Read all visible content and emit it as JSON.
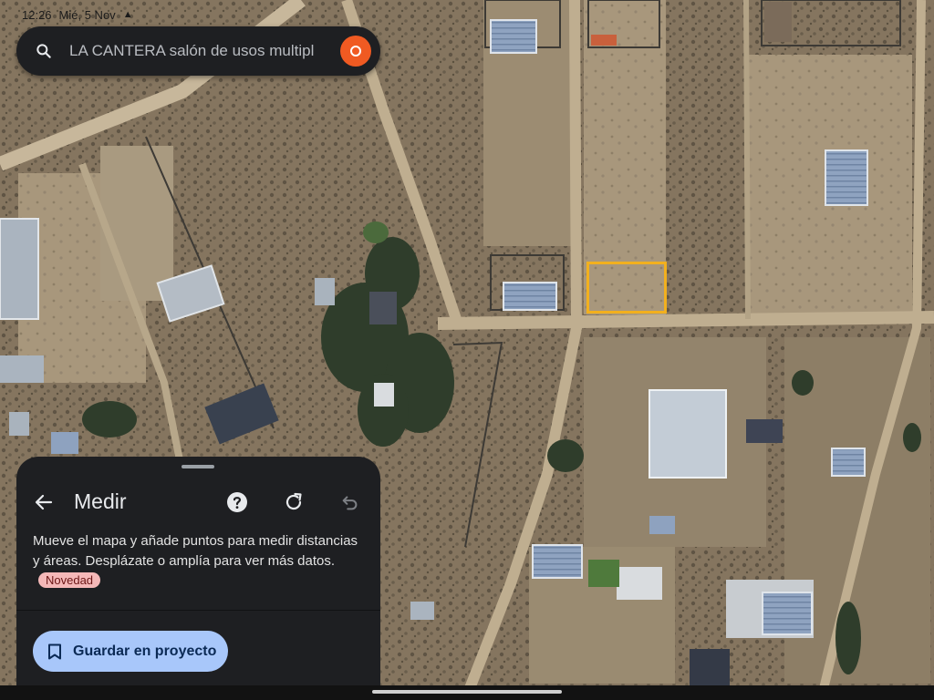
{
  "status_bar": {
    "time": "12:26",
    "date": "Mié, 5 Nov",
    "icon": "navigation-arrow-icon"
  },
  "search": {
    "query": "LA CANTERA salón de usos multipl",
    "icon": "search-icon",
    "avatar_color": "#f05a22"
  },
  "selection": {
    "color": "#f2b01e"
  },
  "measure_panel": {
    "title": "Medir",
    "description": "Mueve el mapa y añade puntos para medir distancias y áreas. Desplázate o amplía para ver más datos.",
    "badge": "Novedad",
    "save_label": "Guardar en proyecto",
    "icons": [
      "back-arrow-icon",
      "help-icon",
      "refresh-icon",
      "undo-icon",
      "bookmark-icon"
    ]
  },
  "colors": {
    "panel": "#1e1f22",
    "button": "#a8c7fa",
    "badge": "#f5b8b8"
  }
}
